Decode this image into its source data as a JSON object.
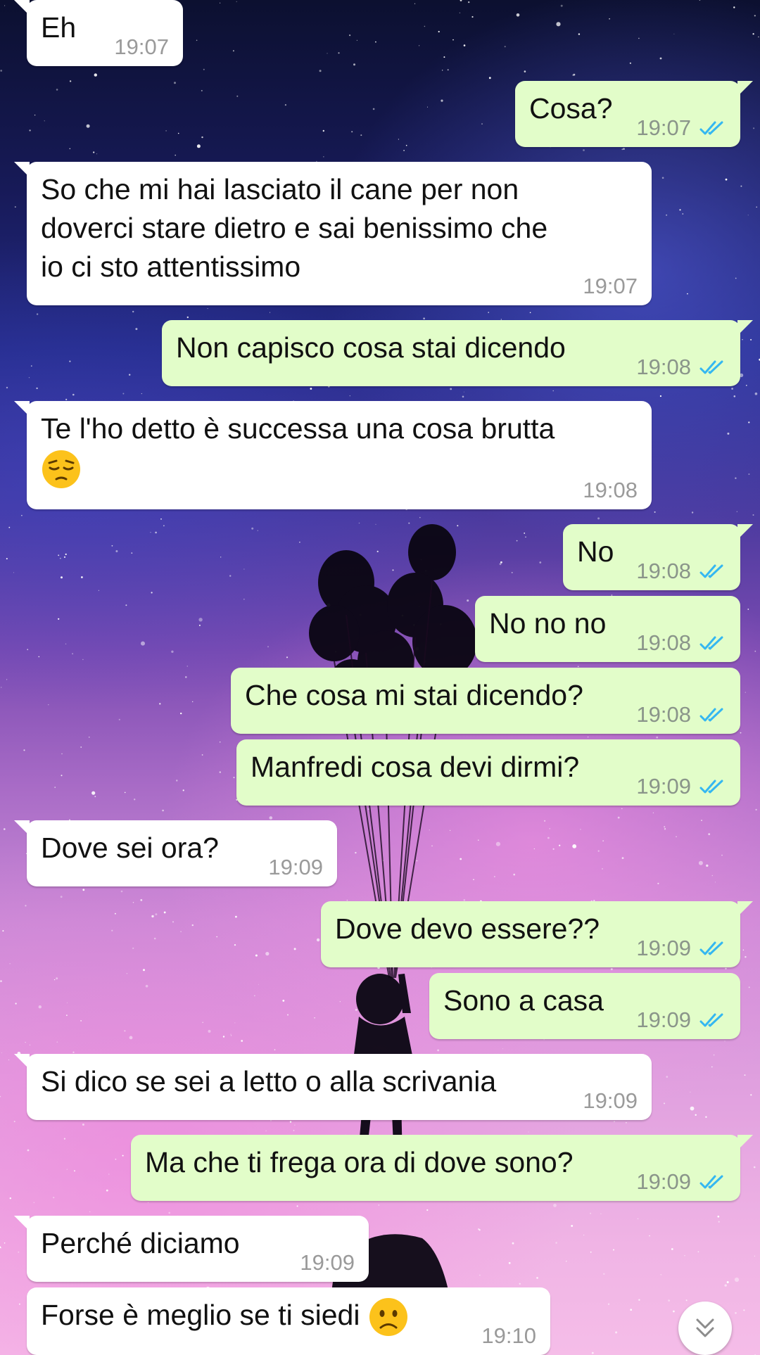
{
  "colors": {
    "incoming_bubble": "#ffffff",
    "outgoing_bubble": "#e2fdc9",
    "read_ticks": "#34b7f1",
    "timestamp": "#9a9a9a"
  },
  "messages": [
    {
      "dir": "in",
      "text": "Eh",
      "time": "19:07"
    },
    {
      "dir": "out",
      "text": "Cosa?",
      "time": "19:07",
      "status": "read"
    },
    {
      "dir": "in",
      "text": "So che mi hai lasciato il cane per non\ndoverci stare dietro e sai benissimo che\nio ci sto attentissimo",
      "time": "19:07"
    },
    {
      "dir": "out",
      "text": "Non capisco cosa stai dicendo",
      "time": "19:08",
      "status": "read"
    },
    {
      "dir": "in",
      "text": "Te l'ho detto è successa una cosa brutta",
      "time": "19:08",
      "emoji": "pensive-face-emoji"
    },
    {
      "dir": "out",
      "text": "No",
      "time": "19:08",
      "status": "read"
    },
    {
      "dir": "out",
      "text": "No no no",
      "time": "19:08",
      "status": "read"
    },
    {
      "dir": "out",
      "text": "Che cosa mi stai dicendo?",
      "time": "19:08",
      "status": "read"
    },
    {
      "dir": "out",
      "text": "Manfredi cosa devi dirmi?",
      "time": "19:09",
      "status": "read"
    },
    {
      "dir": "in",
      "text": "Dove sei ora?",
      "time": "19:09"
    },
    {
      "dir": "out",
      "text": "Dove devo essere??",
      "time": "19:09",
      "status": "read"
    },
    {
      "dir": "out",
      "text": "Sono a casa",
      "time": "19:09",
      "status": "read"
    },
    {
      "dir": "in",
      "text": "Si dico se sei a letto o alla scrivania",
      "time": "19:09"
    },
    {
      "dir": "out",
      "text": "Ma che ti frega ora di dove sono?",
      "time": "19:09",
      "status": "read"
    },
    {
      "dir": "in",
      "text": "Perché diciamo",
      "time": "19:09"
    },
    {
      "dir": "in",
      "text": "Forse è meglio se ti siedi",
      "time": "19:10",
      "emoji": "frowning-face-emoji"
    }
  ],
  "scroll_button": {
    "icon": "double-chevron-down-icon"
  }
}
